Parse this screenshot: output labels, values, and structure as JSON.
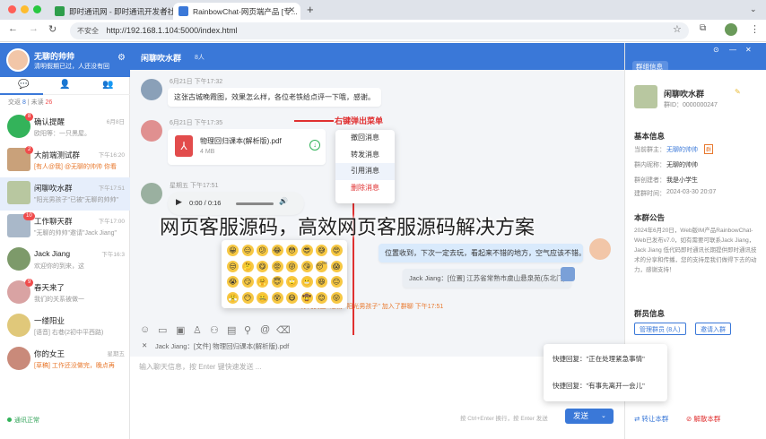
{
  "browser": {
    "tabs": [
      {
        "title": "即时通讯网 - 即时通讯开发者社"
      },
      {
        "title": "RainbowChat-网页端产品 [专..."
      }
    ],
    "new_tab": "+",
    "not_secure": "不安全",
    "url": "http://192.168.1.104:5000/index.html"
  },
  "left": {
    "profile": {
      "name": "无聊的帅帅",
      "status": "清明假期已过，人还没有回"
    },
    "tabs_counts": {
      "total_label": "交返",
      "total": "8",
      "unread_label": "未读",
      "unread": "26"
    },
    "conversations": [
      {
        "name": "确认提醒",
        "time": "6月8日",
        "preview": "欧阳等：一只黑屋。",
        "badge": "8"
      },
      {
        "name": "大前端测试群",
        "time": "下午16:20",
        "preview": "[有人@我] @无聊的帅帅 你看",
        "badge": "2"
      },
      {
        "name": "闲聊吹水群",
        "time": "下午17:51",
        "preview": "\"阳光男孩子\"已被\"无聊的帅帅\"",
        "badge": ""
      },
      {
        "name": "工作聊天群",
        "time": "下午17:00",
        "preview": "\"无聊的帅帅\"邀请\"Jack Jiang\"",
        "badge": "10"
      },
      {
        "name": "Jack Jiang",
        "time": "下午16:3",
        "preview": "欢迎你的到来，这",
        "badge": ""
      },
      {
        "name": "春天来了",
        "time": "",
        "preview": "我们的关系被做一",
        "badge": "9"
      },
      {
        "name": "一缕阳业",
        "time": "",
        "preview": "[语音] 右巷(2初中平西路)",
        "badge": ""
      },
      {
        "name": "你的女王",
        "time": "星期五",
        "preview": "[草稿] 工作还没做完，晚点再",
        "badge": ""
      }
    ],
    "footer": "通讯正常"
  },
  "chat": {
    "title": "闲聊吹水群",
    "member_count": "8人",
    "messages": [
      {
        "time": "6月21日 下午17:32",
        "text": "这张古城晚霞图，效果怎么样，各位老铁给点评一下哦，感谢。"
      },
      {
        "time": "6月21日 下午17:35",
        "file_name": "物理回归课本(解析版).pdf",
        "file_size": "4 MB"
      },
      {
        "time": "星期五 下午17:51",
        "audio": "0:00 / 0:16"
      }
    ],
    "context_menu": [
      "撤回消息",
      "转发消息",
      "引用消息",
      "删除消息"
    ],
    "annotation": "右键弹出菜单",
    "partial_right_bubble": "位置收到，下次一定去玩，看起来不错的地方，空气应该不错。",
    "location_msg": "Jack Jiang：[位置] 江苏省常熟市虞山悬泉苑(东北门)",
    "system_msg": "\"你的女王\" 邀请 \"阳光男孩子\" 加入了群聊  下午17:51",
    "quote": "Jack Jiang：[文件] 物理回归课本(解析版).pdf",
    "input_placeholder": "输入聊天信息，按 Enter 键快速发送 ...",
    "send_hint": "按 Ctrl+Enter 换行，按 Enter 发送",
    "send_label": "发送"
  },
  "quick_replies": [
    "快捷回复：\"正在处理紧急事情\"",
    "快捷回复：\"有事先离开一会儿\""
  ],
  "right": {
    "header": "群组信息",
    "group_name": "闲聊吹水群",
    "group_id": "群ID：0000000247",
    "basic_section": "基本信息",
    "fields": [
      {
        "label": "当前群主：",
        "value": "无聊的帅帅"
      },
      {
        "label": "群内昵称：",
        "value": "无聊的帅帅"
      },
      {
        "label": "群创建者：",
        "value": "我是小学生"
      },
      {
        "label": "建群时间：",
        "value": "2024-03-30 20:07"
      }
    ],
    "owner_tag": "群",
    "notice_section": "本群公告",
    "notice_text": "2024年6月20日，Web版IM产品RainbowChat-Web已发布v7.0，如有需要可联系Jack Jiang，Jack Jiang 低代码即时通讯长期提供即时通讯技术的分享和传播，您的支持是我们做得下去的动力，感谢支持！",
    "members_section": "群员信息",
    "manage_members": "管理群员 (8人)",
    "invite": "邀请入群",
    "transfer": "转让本群",
    "dissolve": "解散本群"
  },
  "overlay_text": "网页客服源码，高效网页客服源码解决方案",
  "colors": {
    "brand": "#3a78d8",
    "danger": "#e03030",
    "accent_orange": "#e8782d"
  }
}
